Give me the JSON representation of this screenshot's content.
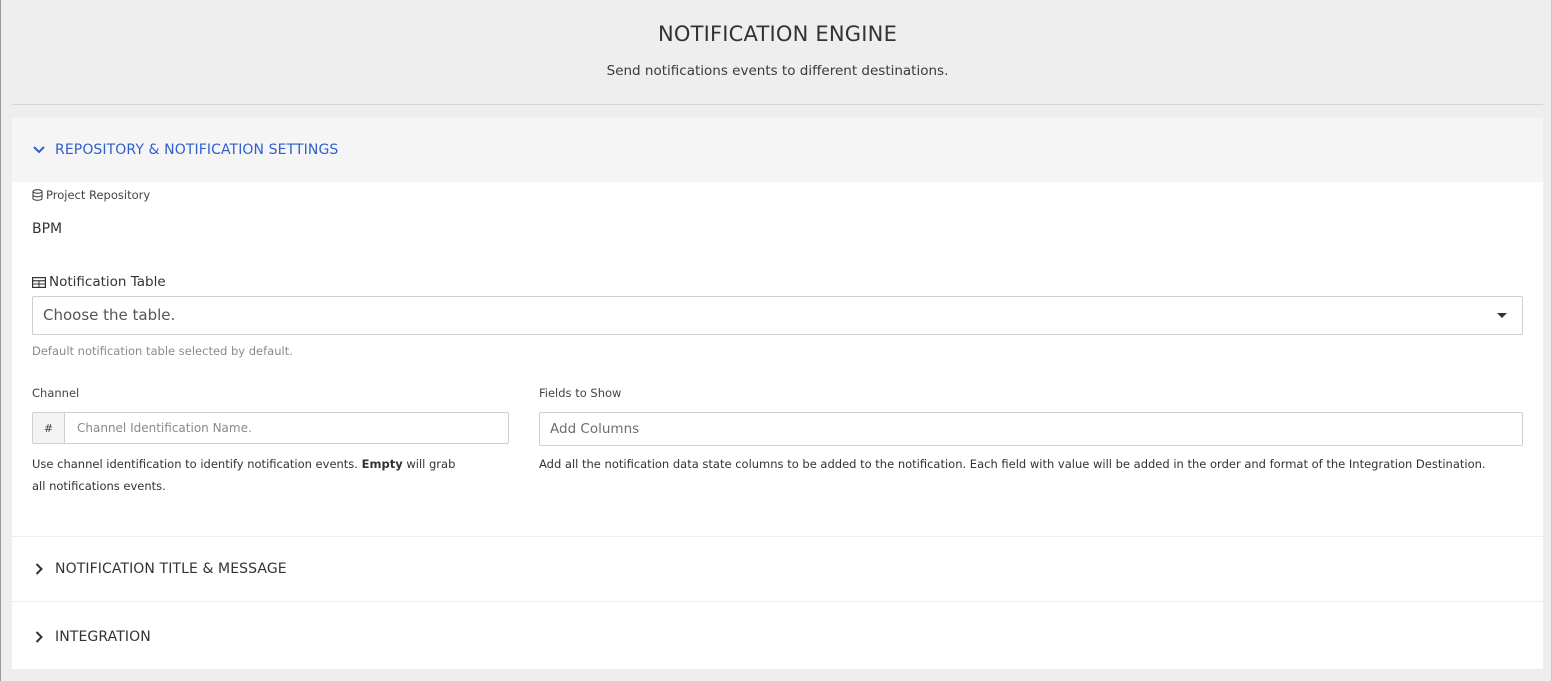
{
  "header": {
    "title": "NOTIFICATION ENGINE",
    "subtitle": "Send notifications events to different destinations."
  },
  "sections": {
    "repository": {
      "label": "REPOSITORY & NOTIFICATION SETTINGS",
      "expanded": true
    },
    "title_message": {
      "label": "NOTIFICATION TITLE & MESSAGE",
      "expanded": false
    },
    "integration": {
      "label": "INTEGRATION",
      "expanded": false
    }
  },
  "repository": {
    "label": "Project Repository",
    "value": "BPM",
    "icon": "database-icon"
  },
  "notification_table": {
    "label": "Notification Table",
    "icon": "table-icon",
    "placeholder": "Choose the table.",
    "help": "Default notification table selected by default."
  },
  "channel": {
    "label": "Channel",
    "addon": "#",
    "placeholder": "Channel Identification Name.",
    "help_before": "Use channel identification to identify notification events. ",
    "help_bold": "Empty",
    "help_after": " will grab all notifications events."
  },
  "fields": {
    "label": "Fields to Show",
    "placeholder": "Add Columns",
    "help": "Add all the notification data state columns to be added to the notification. Each field with value will be added in the order and format of the Integration Destination."
  },
  "colors": {
    "accent": "#2f5ecf",
    "background": "#eeeeee",
    "panel": "#ffffff"
  }
}
